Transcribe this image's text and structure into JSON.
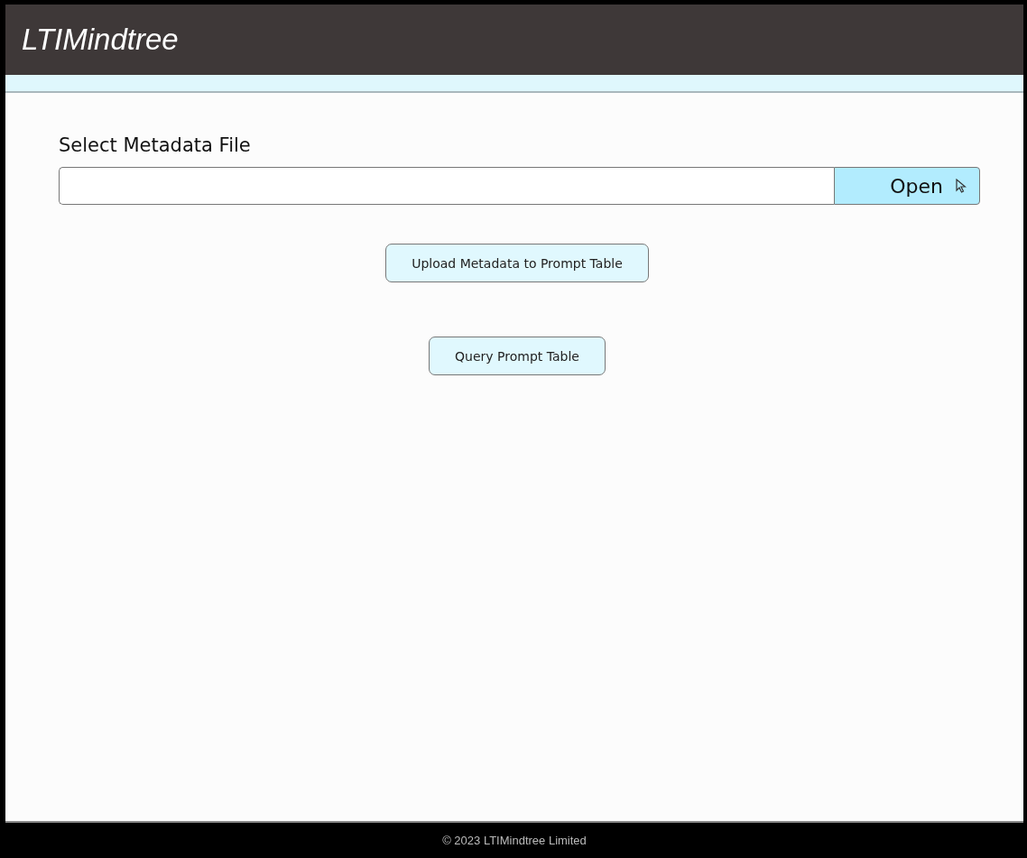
{
  "header": {
    "logo": "LTIMindtree"
  },
  "file_picker": {
    "label": "Select Metadata File",
    "button": "Open"
  },
  "actions": [
    {
      "label": "Upload Metadata to Prompt Table"
    },
    {
      "label": "Query Prompt Table"
    }
  ],
  "footer": {
    "text": "© 2023 LTIMindtree Limited"
  }
}
